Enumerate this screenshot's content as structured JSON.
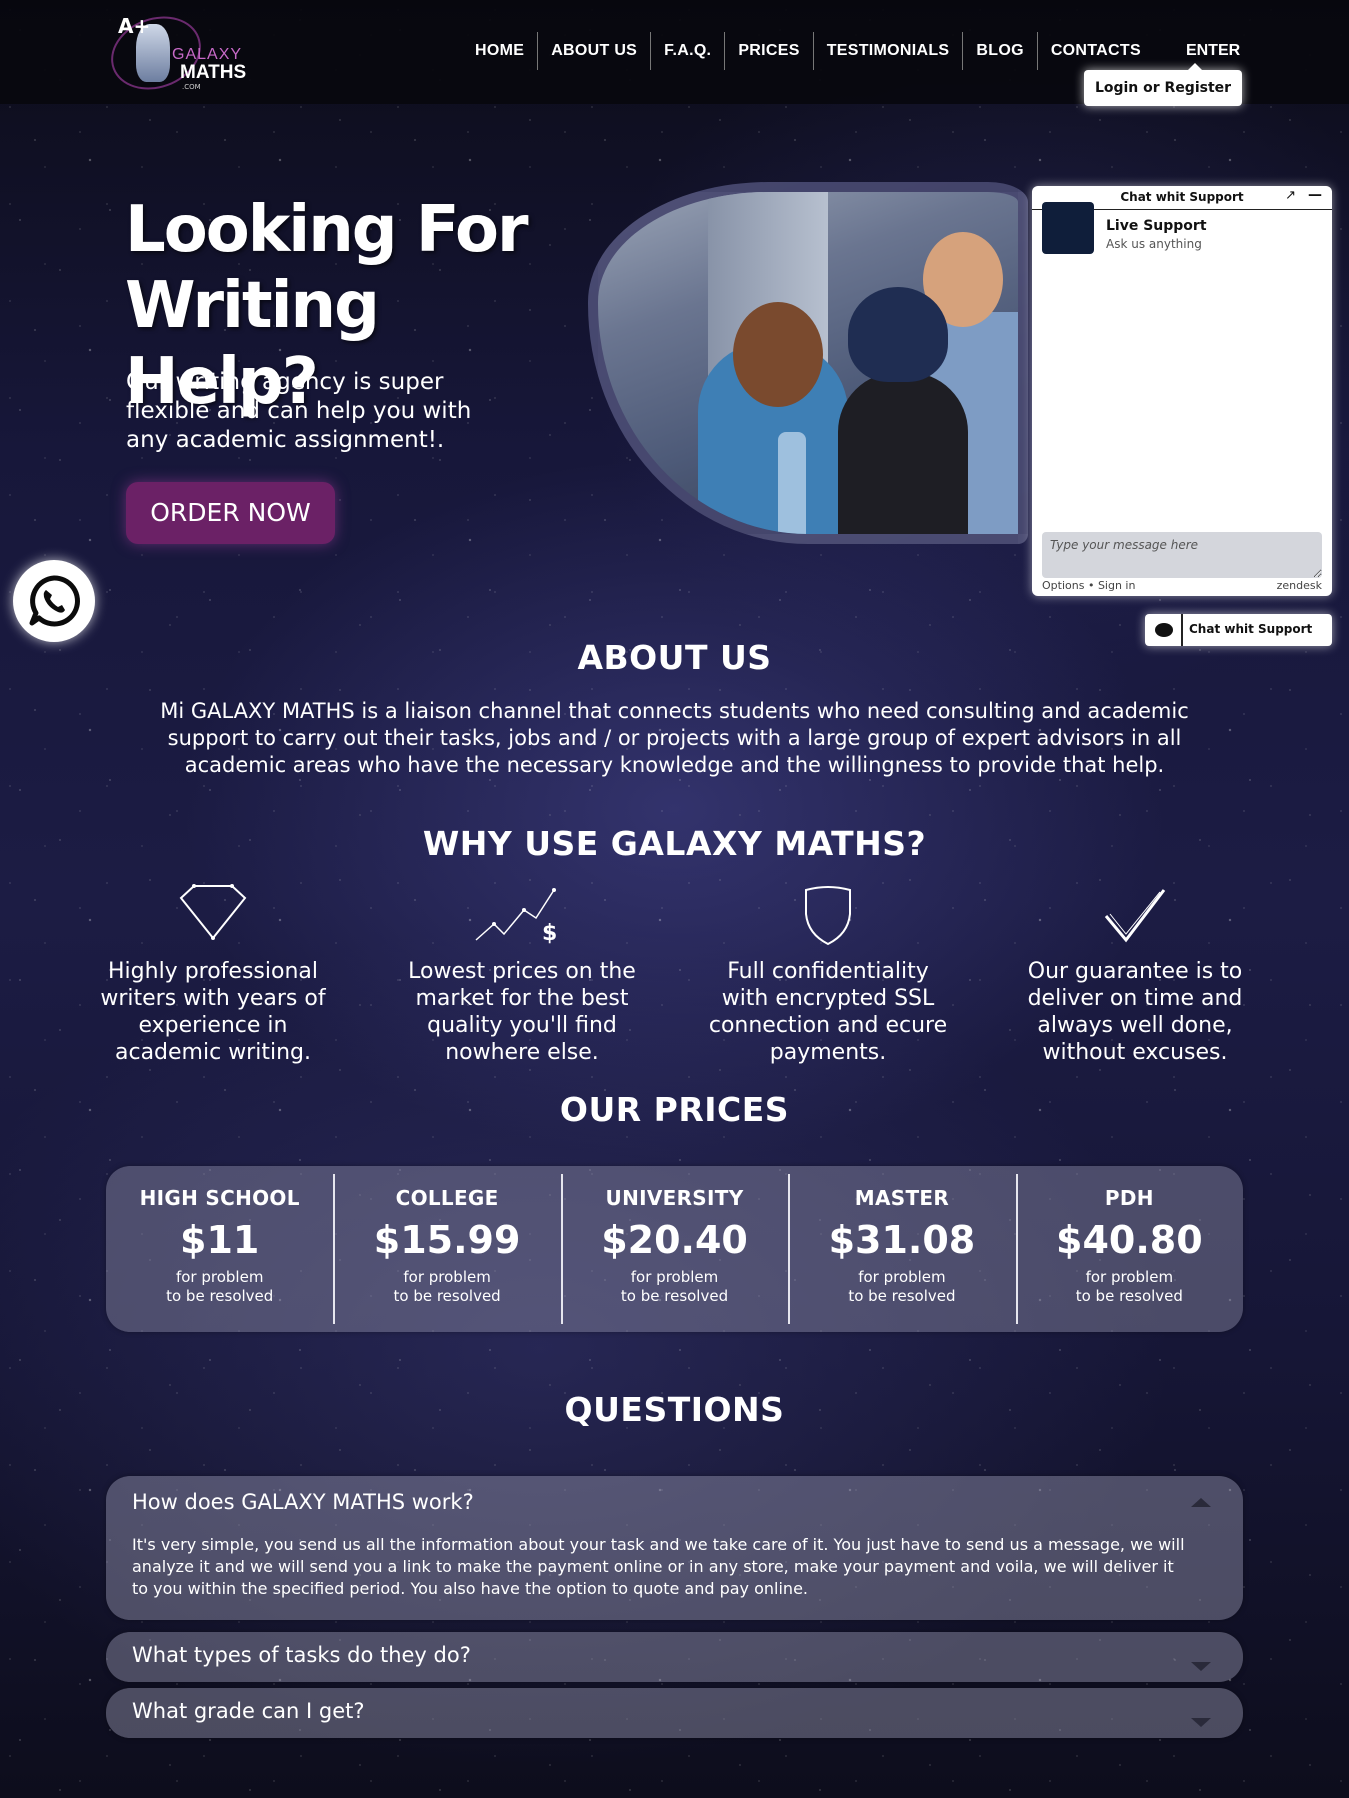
{
  "header": {
    "logo": {
      "aplus": "A+",
      "galaxy": "GALAXY",
      "maths": "MATHS",
      "com": ".COM"
    },
    "nav": [
      "HOME",
      "ABOUT US",
      "F.A.Q.",
      "PRICES",
      "TESTIMONIALS",
      "BLOG",
      "CONTACTS"
    ],
    "enter": "ENTER",
    "login": "Login or Register"
  },
  "hero": {
    "title_line1": "Looking For",
    "title_line2": "Writing Help?",
    "subtitle": "Our writing agency is super flexible and can help you with any academic assignment!.",
    "order_button": "ORDER NOW"
  },
  "chat": {
    "header_title": "Chat  whit Support",
    "popout_icon": "↗",
    "minimize_icon": "—",
    "agent_name": "Live Support",
    "agent_sub": "Ask us anything",
    "input_placeholder": "Type your message here",
    "options": "Options",
    "sign_in": "Sign in",
    "brand": "zendesk",
    "tab_label": "Chat  whit Support"
  },
  "about": {
    "title": "ABOUT US",
    "text": "Mi GALAXY MATHS is a liaison channel that connects students who need consulting and academic support to carry out their tasks, jobs and / or projects with a large group of expert advisors in all academic areas who have the necessary knowledge and the willingness to provide that help."
  },
  "why": {
    "title": "WHY USE GALAXY MATHS?",
    "features": [
      {
        "icon": "diamond-icon",
        "text": "Highly professional writers with years of experience in academic writing."
      },
      {
        "icon": "price-chart-icon",
        "text": "Lowest prices on the market for the best quality you'll find nowhere else."
      },
      {
        "icon": "shield-icon",
        "text": "Full confidentiality with encrypted SSL connection and ecure payments."
      },
      {
        "icon": "checkmark-icon",
        "text": "Our guarantee is to deliver on time and always well done, without excuses."
      }
    ]
  },
  "prices": {
    "title": "OUR PRICES",
    "plans": [
      {
        "name": "HIGH SCHOOL",
        "price": "$11",
        "note1": "for problem",
        "note2": "to be resolved"
      },
      {
        "name": "COLLEGE",
        "price": "$15.99",
        "note1": "for problem",
        "note2": "to be resolved"
      },
      {
        "name": "UNIVERSITY",
        "price": "$20.40",
        "note1": "for problem",
        "note2": "to be resolved"
      },
      {
        "name": "MASTER",
        "price": "$31.08",
        "note1": "for problem",
        "note2": "to be resolved"
      },
      {
        "name": "PDH",
        "price": "$40.80",
        "note1": "for problem",
        "note2": "to be resolved"
      }
    ]
  },
  "questions": {
    "title": "QUESTIONS",
    "items": [
      {
        "q": "How does GALAXY MATHS work?",
        "a": "It's very simple, you send us all the information about your task and we take care of it. You just have to send us a message, we will analyze it and we will send you a link to make the payment online or in any store, make your payment and voila, we will deliver it to you within the specified period. You also have the option to quote and pay online."
      },
      {
        "q": "What types of tasks do they do?"
      },
      {
        "q": "What grade can I get?"
      }
    ]
  },
  "colors": {
    "accent": "#6b2166",
    "card": "#8c8ca5"
  }
}
